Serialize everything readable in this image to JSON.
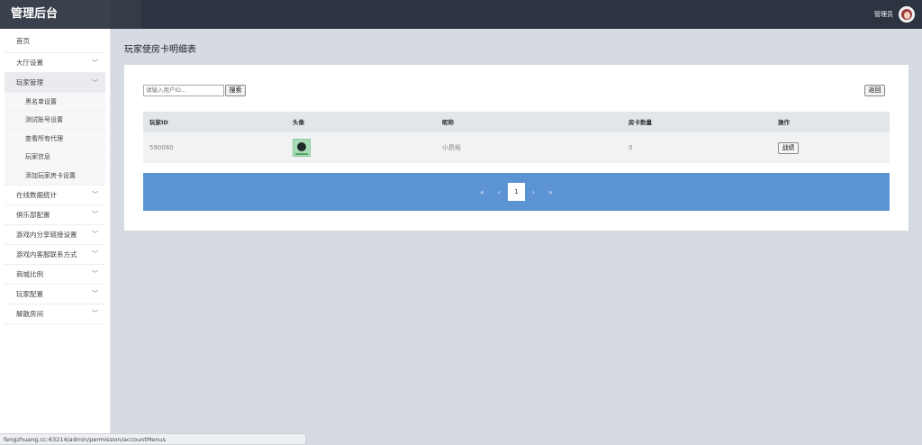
{
  "header": {
    "brand": "管理后台",
    "user_name": "管理员"
  },
  "sidebar": {
    "items": [
      {
        "label": "首页"
      },
      {
        "label": "大厅设置",
        "chevron": "﹀"
      },
      {
        "label": "玩家管理",
        "chevron": "﹀"
      },
      {
        "label": "在线数据统计",
        "chevron": "﹀"
      },
      {
        "label": "俱乐部配置",
        "chevron": "﹀"
      },
      {
        "label": "游戏内分享链接设置",
        "chevron": "﹀"
      },
      {
        "label": "游戏内客服联系方式",
        "chevron": "﹀"
      },
      {
        "label": "商城比例",
        "chevron": "﹀"
      },
      {
        "label": "玩家配置",
        "chevron": "﹀"
      },
      {
        "label": "解散房间",
        "chevron": "﹀"
      }
    ],
    "sub_items": [
      {
        "label": "黑名单设置"
      },
      {
        "label": "测试账号设置"
      },
      {
        "label": "查看所有代理"
      },
      {
        "label": "玩家信息"
      },
      {
        "label": "添加玩家房卡设置"
      }
    ]
  },
  "main": {
    "title": "玩家使房卡明细表",
    "search": {
      "placeholder": "请输入用户ID...",
      "button": "搜索"
    },
    "back_button": "返回",
    "table": {
      "headers": [
        "玩家ID",
        "头像",
        "昵称",
        "房卡数量",
        "操作"
      ],
      "rows": [
        {
          "id": "590060",
          "nickname": "小昂裕",
          "cards": "0",
          "action": "战绩"
        }
      ]
    },
    "pagination": {
      "first": "«",
      "prev": "‹",
      "current": "1",
      "next": "›",
      "last": "»"
    }
  },
  "status_bar": {
    "url": "fengzhuang.cc:63214/admin/permission/accountMenus"
  }
}
